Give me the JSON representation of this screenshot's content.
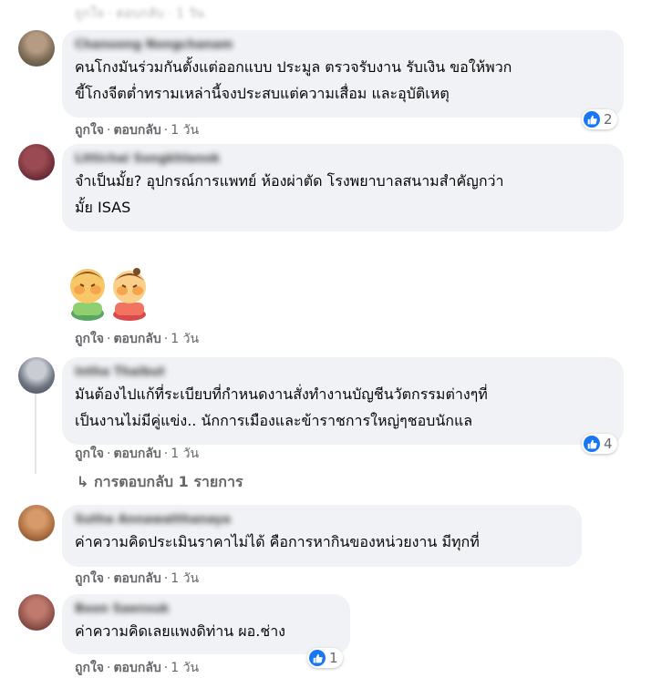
{
  "top_row": {
    "actions": "ถูกใจ · ตอบกลับ · 1 วัน"
  },
  "action_labels": {
    "like": "ถูกใจ",
    "reply": "ตอบกลับ",
    "sep": "·"
  },
  "comments": [
    {
      "author": "Chanoong Nongchanam",
      "lines": [
        "คนโกงมันร่วมกันตั้งแต่ออกแบบ ประมูล ตรวจรับงาน รับเงิน ขอให้พวก",
        "ขี้โกงจีตต่ำทรามเหล่านี้จงประสบแต่ความเสื่อม และอุบัติเหตุ"
      ],
      "time": "1 วัน",
      "reactions": "2"
    },
    {
      "author": "Littichai Songkhlanok",
      "lines": [
        "จำเป็นมั้ย? อุปกรณ์การแพทย์ ห้องผ่าตัด โรงพยาบาลสนามสำคัญกว่า",
        "มั้ย ISAS"
      ],
      "time": ""
    },
    {
      "author": "",
      "sticker": "two-kids-laughing-sticker",
      "time": "1 วัน"
    },
    {
      "author": "Intha Thaibut",
      "lines": [
        "มันต้องไปแก้ที่ระเบียบที่กำหนดงานสั่งทำงานบัญชีนวัตกรรมต่างๆที่",
        "เป็นงานไม่มีคู่แข่ง.. นักการเมืองและข้าราชการใหญ่ๆชอบนักแล"
      ],
      "time": "1 วัน",
      "reactions": "4",
      "view_replies": "↳ การตอบกลับ 1 รายการ"
    },
    {
      "author": "Sutha Annawatthanaya",
      "lines": [
        "ค่าความคิดประเมินราคาไม่ได้ คือการหากินของหน่วยงาน มีทุกที่"
      ],
      "time": "1 วัน"
    },
    {
      "author": "Boon Saensuk",
      "lines": [
        "ค่าความคิดเลยแพงดิท่าน ผอ.ช่าง"
      ],
      "time": "1 วัน",
      "reactions": "1"
    }
  ],
  "colors": {
    "bubble": "#f0f2f5",
    "meta": "#65676b",
    "like": "#1877f2",
    "text": "#050505"
  }
}
